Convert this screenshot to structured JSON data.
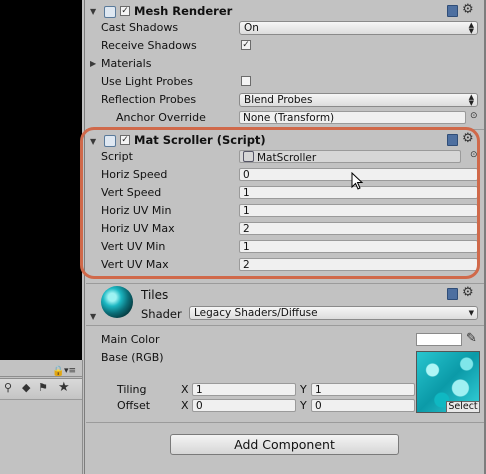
{
  "mesh_renderer": {
    "title": "Mesh Renderer",
    "enabled": "✓",
    "props": [
      {
        "label": "Cast Shadows",
        "value": "On"
      },
      {
        "label": "Receive Shadows",
        "value": "✓"
      },
      {
        "label": "Materials"
      },
      {
        "label": "Use Light Probes",
        "value": ""
      },
      {
        "label": "Reflection Probes",
        "value": "Blend Probes"
      },
      {
        "label": "Anchor Override",
        "value": "None (Transform)"
      }
    ]
  },
  "mat_scroller": {
    "title": "Mat Scroller (Script)",
    "enabled": "✓",
    "script_label": "Script",
    "script_value": "MatScroller",
    "props": [
      {
        "label": "Horiz Speed",
        "value": "0"
      },
      {
        "label": "Vert Speed",
        "value": "1"
      },
      {
        "label": "Horiz UV Min",
        "value": "1"
      },
      {
        "label": "Horiz UV Max",
        "value": "2"
      },
      {
        "label": "Vert UV Min",
        "value": "1"
      },
      {
        "label": "Vert UV Max",
        "value": "2"
      }
    ]
  },
  "material": {
    "name": "Tiles",
    "shader_label": "Shader",
    "shader_value": "Legacy Shaders/Diffuse",
    "main_color_label": "Main Color",
    "base_label": "Base (RGB)",
    "tiling_label": "Tiling",
    "offset_label": "Offset",
    "x_label": "X",
    "y_label": "Y",
    "tiling_x": "1",
    "tiling_y": "1",
    "offset_x": "0",
    "offset_y": "0",
    "select_label": "Select",
    "main_color": "#ffffff"
  },
  "add_component_label": "Add Component",
  "icons": {
    "gear": "⚙",
    "dropdown_arrow": "⬍",
    "object_picker": "⊙",
    "foldout_open": "▼",
    "foldout_closed": "▶",
    "eyedropper": "✎"
  },
  "colors": {
    "highlight": "#d0694a",
    "panel_bg": "#c2c2c2"
  }
}
